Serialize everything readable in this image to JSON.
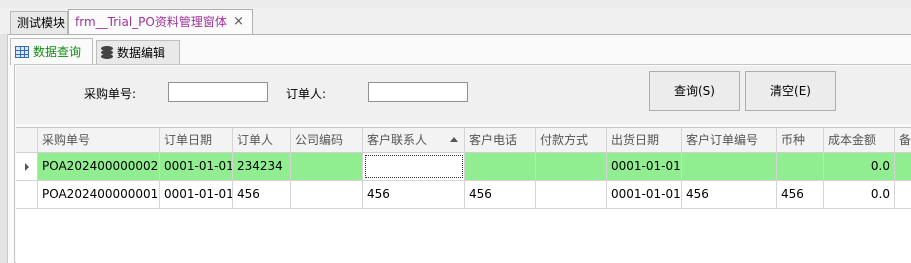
{
  "doc_tabs": [
    {
      "label": "测试模块"
    },
    {
      "label": "frm__Trial_PO资料管理窗体",
      "close": "×"
    }
  ],
  "inner_tabs": [
    {
      "label": "数据查询",
      "icon": "grid-icon"
    },
    {
      "label": "数据编辑",
      "icon": "database-icon"
    }
  ],
  "search": {
    "po_label": "采购单号:",
    "po_value": "",
    "orderer_label": "订单人:",
    "orderer_value": "",
    "query_button": "查询(S)",
    "clear_button": "清空(E)"
  },
  "grid": {
    "columns": [
      "采购单号",
      "订单日期",
      "订单人",
      "公司编码",
      "客户联系人",
      "客户电话",
      "付款方式",
      "出货日期",
      "客户订单编号",
      "币种",
      "成本金额",
      "备"
    ],
    "sorted_column": "客户联系人",
    "rows": [
      [
        "POA202400000002",
        "0001-01-01",
        "234234",
        "",
        "",
        "",
        "",
        "0001-01-01",
        "",
        "",
        "0.0",
        ""
      ],
      [
        "POA202400000001",
        "0001-01-01",
        "456",
        "",
        "456",
        "456",
        "",
        "0001-01-01",
        "456",
        "456",
        "0.0",
        ""
      ]
    ],
    "selected_row_color": "#90ee90"
  }
}
